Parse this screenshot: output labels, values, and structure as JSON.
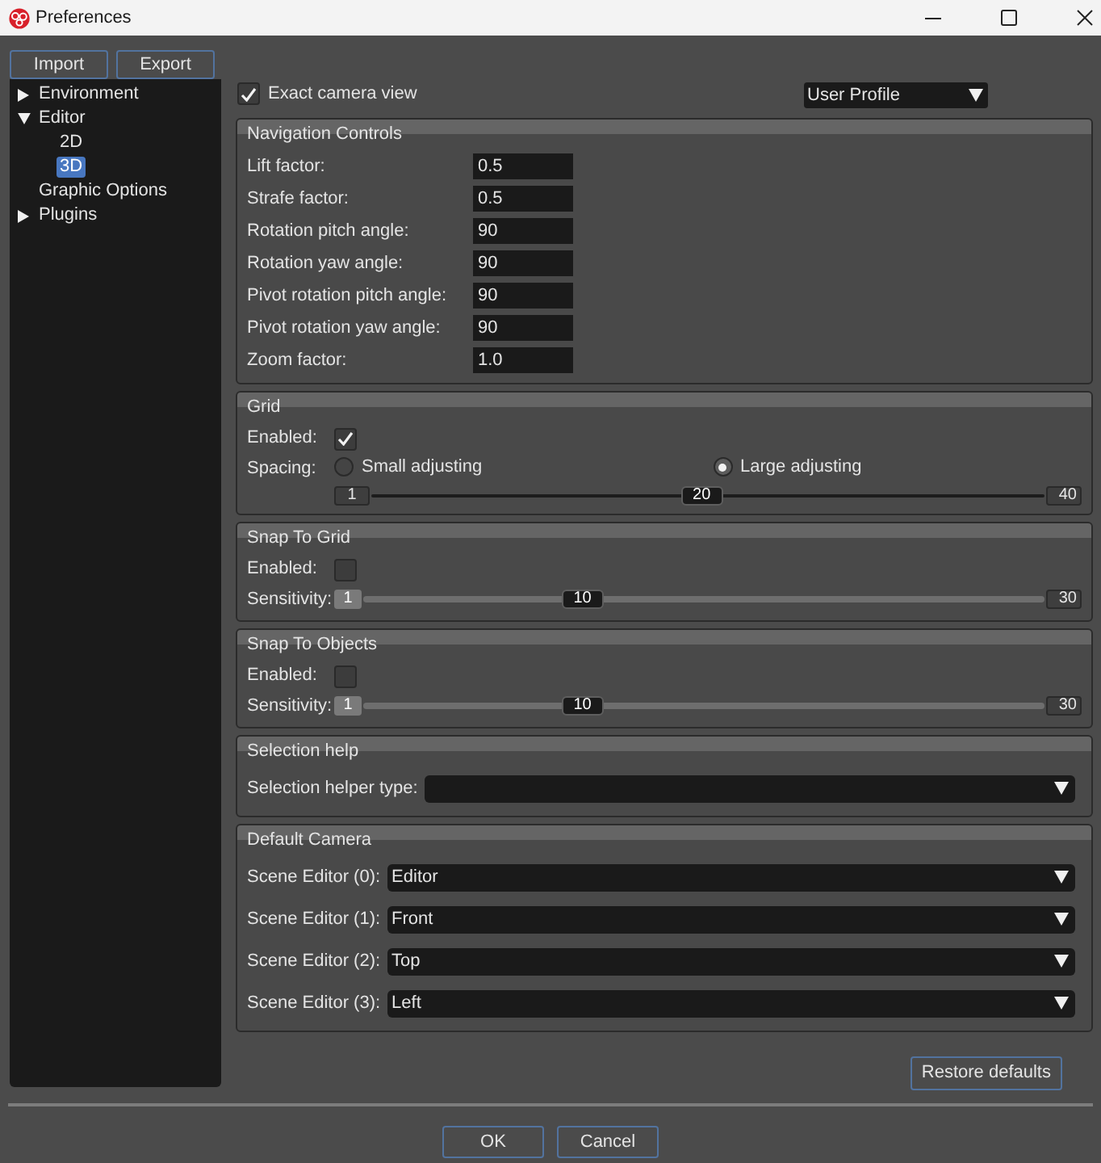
{
  "window": {
    "title": "Preferences"
  },
  "toolbar": {
    "buttons": [
      "Import",
      "Export"
    ]
  },
  "sidebar": {
    "items": [
      {
        "label": "Environment",
        "expanded": false,
        "selected": false
      },
      {
        "label": "Editor",
        "expanded": true,
        "selected": false,
        "children": [
          {
            "label": "2D",
            "selected": false
          },
          {
            "label": "3D",
            "selected": true
          }
        ]
      },
      {
        "label": "Graphic Options",
        "selected": false
      },
      {
        "label": "Plugins",
        "expanded": false,
        "selected": false
      }
    ]
  },
  "exact_camera_view": {
    "label": "Exact camera view",
    "checked": true
  },
  "profile_dropdown": {
    "value": "User Profile"
  },
  "groups": [
    {
      "title": "Navigation Controls",
      "rows": [
        {
          "kind": "field",
          "label": "Lift factor:",
          "value": "0.5"
        },
        {
          "kind": "field",
          "label": "Strafe factor:",
          "value": "0.5"
        },
        {
          "kind": "field",
          "label": "Rotation pitch angle:",
          "value": "90"
        },
        {
          "kind": "field",
          "label": "Rotation yaw angle:",
          "value": "90"
        },
        {
          "kind": "field",
          "label": "Pivot rotation pitch angle:",
          "value": "90"
        },
        {
          "kind": "field",
          "label": "Pivot rotation yaw angle:",
          "value": "90"
        },
        {
          "kind": "field",
          "label": "Zoom factor:",
          "value": "1.0"
        }
      ]
    },
    {
      "title": "Grid",
      "rows": [
        {
          "kind": "checkbox",
          "label": "Enabled:",
          "checked": true
        },
        {
          "kind": "radio",
          "label": "Spacing:",
          "options": [
            {
              "label": "Small adjusting",
              "selected": false
            },
            {
              "label": "Large adjusting",
              "selected": true
            }
          ]
        },
        {
          "kind": "slider",
          "groove": false,
          "min": "1",
          "max": "40",
          "value": "20",
          "level": 0.49
        }
      ]
    },
    {
      "title": "Snap To Grid",
      "rows": [
        {
          "kind": "checkbox",
          "label": "Enabled:",
          "checked": false
        },
        {
          "kind": "slider",
          "groove": true,
          "label": "Sensitivity:",
          "min": "1",
          "max": "30",
          "value": "10",
          "level": 0.31
        }
      ]
    },
    {
      "title": "Snap To Objects",
      "rows": [
        {
          "kind": "checkbox",
          "label": "Enabled:",
          "checked": false
        },
        {
          "kind": "slider",
          "groove": true,
          "label": "Sensitivity:",
          "min": "1",
          "max": "30",
          "value": "10",
          "level": 0.31
        }
      ]
    },
    {
      "title": "Selection help",
      "rows": [
        {
          "kind": "dropdown",
          "label": "Selection helper type:"
        }
      ]
    },
    {
      "title": "Default Camera",
      "rows": [
        {
          "kind": "dropdown",
          "label": "Scene Editor (0):",
          "value": "Editor"
        },
        {
          "kind": "dropdown",
          "label": "Scene Editor (1):",
          "value": "Front"
        },
        {
          "kind": "dropdown",
          "label": "Scene Editor (2):",
          "value": "Top"
        },
        {
          "kind": "dropdown",
          "label": "Scene Editor (3):",
          "value": "Left"
        }
      ]
    }
  ],
  "restore_button": "Restore defaults",
  "dialog_buttons": [
    "OK",
    "Cancel"
  ]
}
